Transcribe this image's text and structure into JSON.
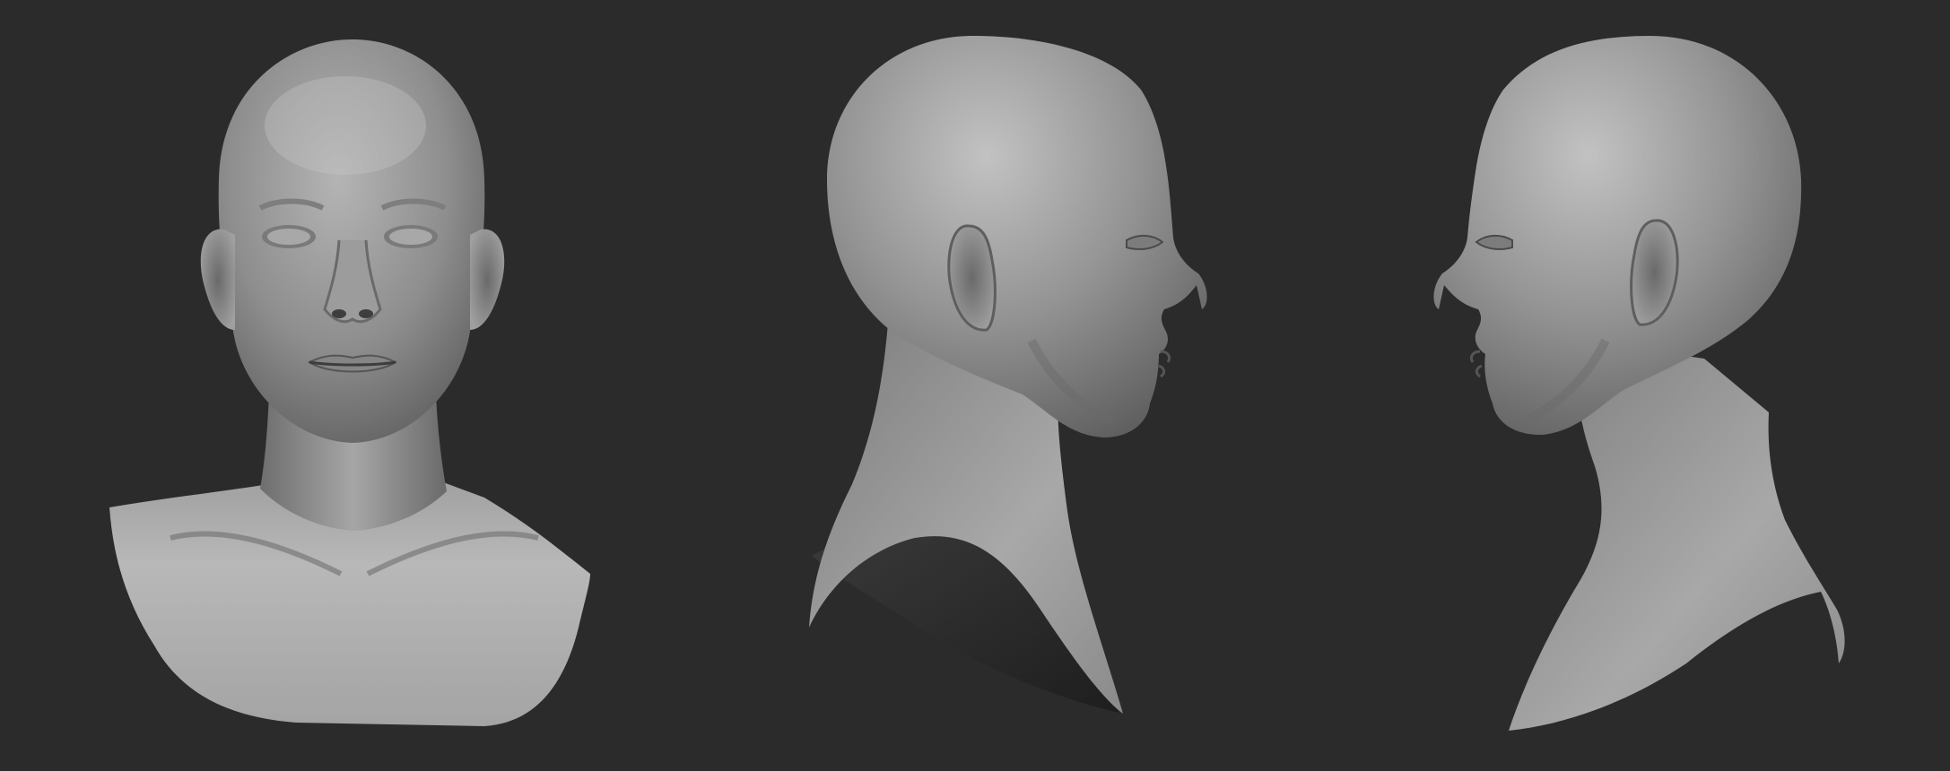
{
  "scene": {
    "background_color": "#2b2b2b",
    "material_color": "#8f8f8f",
    "views": [
      {
        "name": "front-view",
        "kind": "front"
      },
      {
        "name": "right-profile-view",
        "kind": "profile-right"
      },
      {
        "name": "left-profile-view",
        "kind": "profile-left"
      }
    ]
  }
}
